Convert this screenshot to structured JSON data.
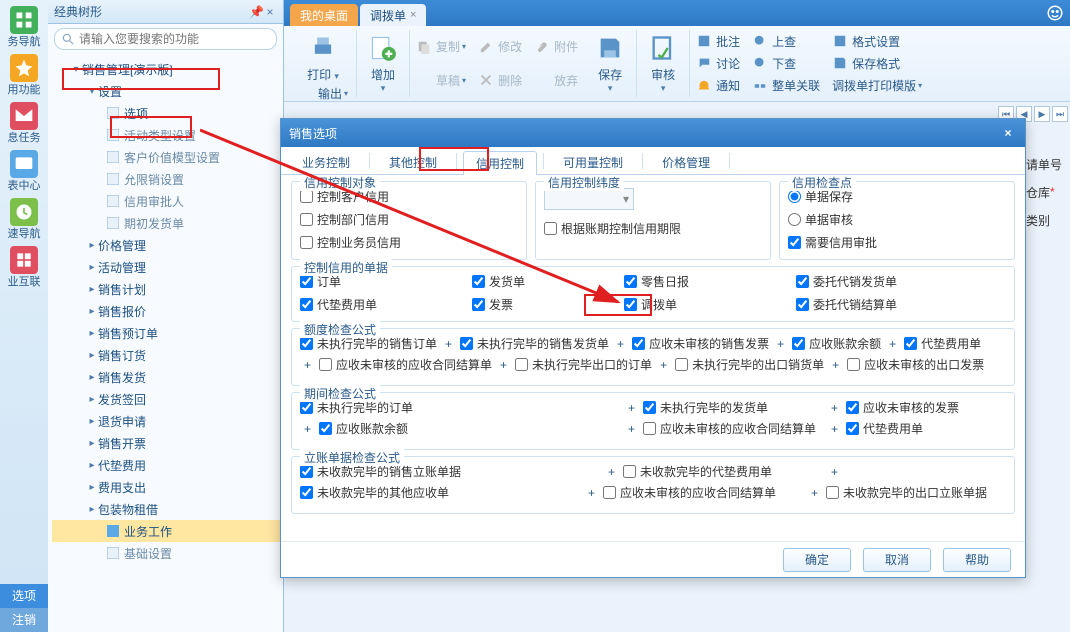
{
  "rail": {
    "items": [
      {
        "label": "务导航",
        "color": "#43b05c"
      },
      {
        "label": "用功能",
        "color": "#f5a623"
      },
      {
        "label": "息任务",
        "color": "#e04f5f"
      },
      {
        "label": "表中心",
        "color": "#5aa9e6"
      },
      {
        "label": "速导航",
        "color": "#7cc04b"
      },
      {
        "label": "业互联",
        "color": "#e04f5f"
      }
    ],
    "bottom": {
      "a": "选项",
      "b": "注销"
    }
  },
  "tree": {
    "title": "经典树形",
    "search_placeholder": "请输入您要搜索的功能",
    "root": "销售管理[演示版]",
    "settings": "设置",
    "settings_children": [
      "选项",
      "活动类型设置",
      "客户价值模型设置",
      "允限销设置",
      "信用审批人",
      "期初发货单"
    ],
    "sections": [
      "价格管理",
      "活动管理",
      "销售计划",
      "销售报价",
      "销售预订单",
      "销售订货",
      "销售发货",
      "发货签回",
      "退货申请",
      "销售开票",
      "代垫费用",
      "费用支出",
      "包装物租借"
    ],
    "biz": "业务工作",
    "base": "基础设置"
  },
  "tabs": {
    "a": "我的桌面",
    "b": "调拨单"
  },
  "ribbon": {
    "print": "打印",
    "output": "输出",
    "add": "增加",
    "draft": "草稿",
    "copy": "复制",
    "modify": "修改",
    "delete": "删除",
    "attach": "附件",
    "abandon": "放弃",
    "save": "保存",
    "audit": "审核",
    "approve": "批注",
    "discuss": "讨论",
    "notify": "通知",
    "up": "上查",
    "down": "下查",
    "related": "整单关联",
    "format": "格式设置",
    "saveformat": "保存格式",
    "template": "调拨单打印模版"
  },
  "rightfields": {
    "a": "请单号",
    "b": "仓库",
    "c": "类别"
  },
  "dialog": {
    "title": "销售选项",
    "tabs": [
      "业务控制",
      "其他控制",
      "信用控制",
      "可用量控制",
      "价格管理"
    ],
    "g1": {
      "legend": "信用控制对象",
      "items": [
        "控制客户信用",
        "控制部门信用",
        "控制业务员信用"
      ]
    },
    "g2": {
      "legend": "信用控制纬度",
      "chk": "根据账期控制信用期限"
    },
    "g3": {
      "legend": "信用检查点",
      "r1": "单据保存",
      "r2": "单据审核",
      "chk": "需要信用审批"
    },
    "g4": {
      "legend": "控制信用的单据",
      "items": [
        "订单",
        "发货单",
        "零售日报",
        "委托代销发货单",
        "代垫费用单",
        "发票",
        "调拨单",
        "委托代销结算单"
      ]
    },
    "g5": {
      "legend": "额度检查公式",
      "items": [
        "未执行完毕的销售订单",
        "未执行完毕的销售发货单",
        "应收未审核的销售发票",
        "应收账款余额",
        "代垫费用单",
        "应收未审核的应收合同结算单",
        "未执行完毕出口的订单",
        "未执行完毕的出口销货单",
        "应收未审核的出口发票"
      ]
    },
    "g6": {
      "legend": "期间检查公式",
      "items": [
        "未执行完毕的订单",
        "未执行完毕的发货单",
        "应收未审核的发票",
        "应收账款余额",
        "应收未审核的应收合同结算单",
        "代垫费用单"
      ]
    },
    "g7": {
      "legend": "立账单据检查公式",
      "items": [
        "未收款完毕的销售立账单据",
        "未收款完毕的代垫费用单",
        "未收款完毕的其他应收单",
        "应收未审核的应收合同结算单",
        "未收款完毕的出口立账单据"
      ]
    },
    "buttons": {
      "ok": "确定",
      "cancel": "取消",
      "help": "帮助"
    }
  }
}
